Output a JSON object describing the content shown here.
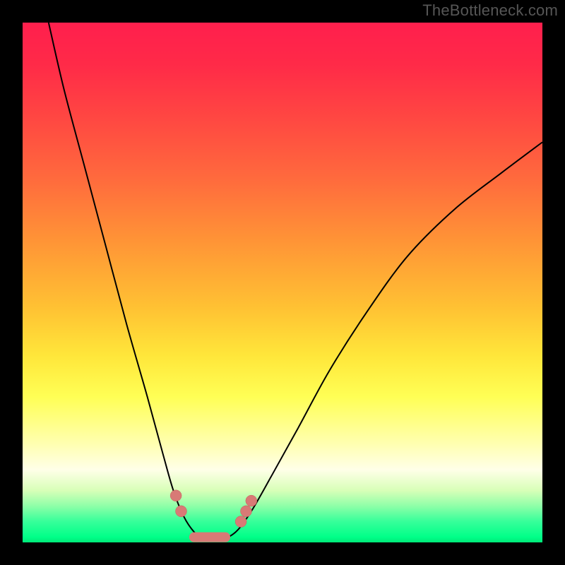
{
  "watermark": "TheBottleneck.com",
  "chart_data": {
    "type": "line",
    "title": "",
    "xlabel": "",
    "ylabel": "",
    "xlim": [
      0,
      100
    ],
    "ylim": [
      0,
      100
    ],
    "series": [
      {
        "name": "bottleneck-curve",
        "x": [
          5,
          8,
          12,
          16,
          20,
          24,
          27,
          29,
          31,
          33,
          35,
          38,
          41,
          44,
          48,
          53,
          59,
          66,
          74,
          83,
          92,
          100
        ],
        "y": [
          100,
          87,
          72,
          57,
          42,
          28,
          17,
          10,
          5,
          2,
          0.5,
          0.5,
          2,
          6,
          13,
          22,
          33,
          44,
          55,
          64,
          71,
          77
        ]
      }
    ],
    "highlighted_points": {
      "name": "near-optimal-dots",
      "x": [
        29.5,
        30.5,
        33,
        35,
        37,
        39,
        42,
        43,
        44
      ],
      "y": [
        9,
        6,
        1,
        0.5,
        0.5,
        1,
        4,
        6,
        8
      ]
    },
    "gradient_meaning": "top (red) = high bottleneck, bottom (green) = balanced"
  }
}
